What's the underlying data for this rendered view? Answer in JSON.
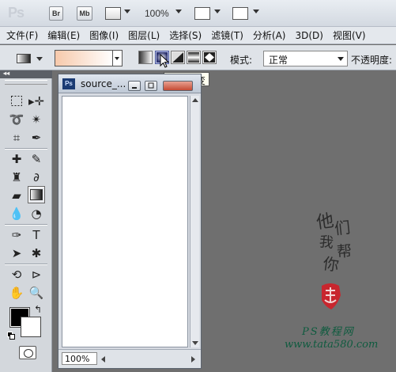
{
  "app": {
    "logo": "Ps",
    "bridge_label": "Br",
    "minibridge_label": "Mb",
    "zoom": "100%"
  },
  "menu": [
    "文件(F)",
    "编辑(E)",
    "图像(I)",
    "图层(L)",
    "选择(S)",
    "滤镜(T)",
    "分析(A)",
    "3D(D)",
    "视图(V)"
  ],
  "options": {
    "gradient_types": [
      "linear-gradient-icon",
      "radial-gradient-icon",
      "angle-gradient-icon",
      "reflected-gradient-icon",
      "diamond-gradient-icon"
    ],
    "active_gradient": "radial-gradient-icon",
    "tooltip": "径向渐变",
    "mode_label": "模式:",
    "mode_value": "正常",
    "opacity_label": "不透明度:",
    "gradient_colors": [
      "#f7c9ab",
      "#ffffff"
    ]
  },
  "document": {
    "title": "source_...",
    "zoom": "100%"
  },
  "colors": {
    "foreground": "#000000",
    "background": "#ffffff",
    "workspace": "#6f6f6f"
  },
  "watermark": {
    "calligraphy_1": "他",
    "calligraphy_2": "们",
    "calligraphy_3": "我",
    "calligraphy_4": "帮",
    "calligraphy_5": "你",
    "ps_line": "PS教程网",
    "url": "www.tata580.com"
  }
}
